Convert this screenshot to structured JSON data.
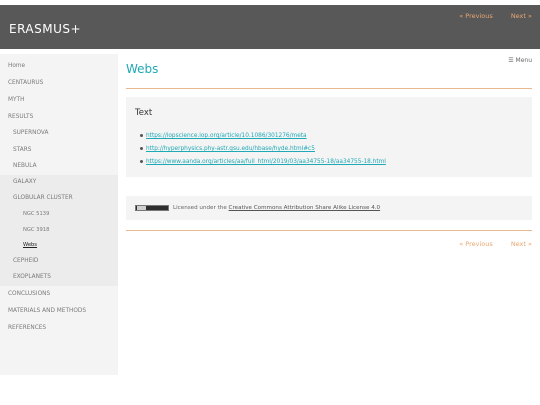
{
  "header": {
    "site_title": "ERASMUS+",
    "prev_label": "« Previous",
    "next_label": "Next »"
  },
  "sidebar": {
    "items": [
      {
        "label": "Home"
      },
      {
        "label": "CENTAURUS"
      },
      {
        "label": "MYTH"
      },
      {
        "label": "RESULTS"
      },
      {
        "label": "SUPERNOVA"
      },
      {
        "label": "STARS"
      },
      {
        "label": "NEBULA"
      },
      {
        "label": "GALAXY"
      },
      {
        "label": "GLOBULAR CLUSTER"
      },
      {
        "label": "NGC 5139"
      },
      {
        "label": "NGC 3918"
      },
      {
        "label": "Webs"
      },
      {
        "label": "CEPHEID"
      },
      {
        "label": "EXOPLANETS"
      },
      {
        "label": "CONCLUSIONS"
      },
      {
        "label": "MATERIALS AND METHODS"
      },
      {
        "label": "REFERENCES"
      }
    ]
  },
  "main": {
    "title": "Webs",
    "menu_label": "☰ Menu",
    "panel_heading": "Text",
    "links": [
      "https://iopscience.iop.org/article/10.1086/301276/meta",
      "http://hyperphysics.phy-astr.gsu.edu/hbase/hyde.html#c5",
      "https://www.aanda.org/articles/aa/full_html/2019/03/aa34755-18/aa34755-18.html"
    ],
    "license_prefix": "Licensed under the ",
    "license_link": "Creative Commons Attribution Share Alike License 4.0",
    "cc_badge_icon": "cc-by-sa-icon"
  },
  "footer_nav": {
    "prev_label": "« Previous",
    "next_label": "Next »"
  },
  "colors": {
    "header_bg": "#585858",
    "accent_teal": "#1fa8b5",
    "accent_orange": "#e8a772"
  }
}
